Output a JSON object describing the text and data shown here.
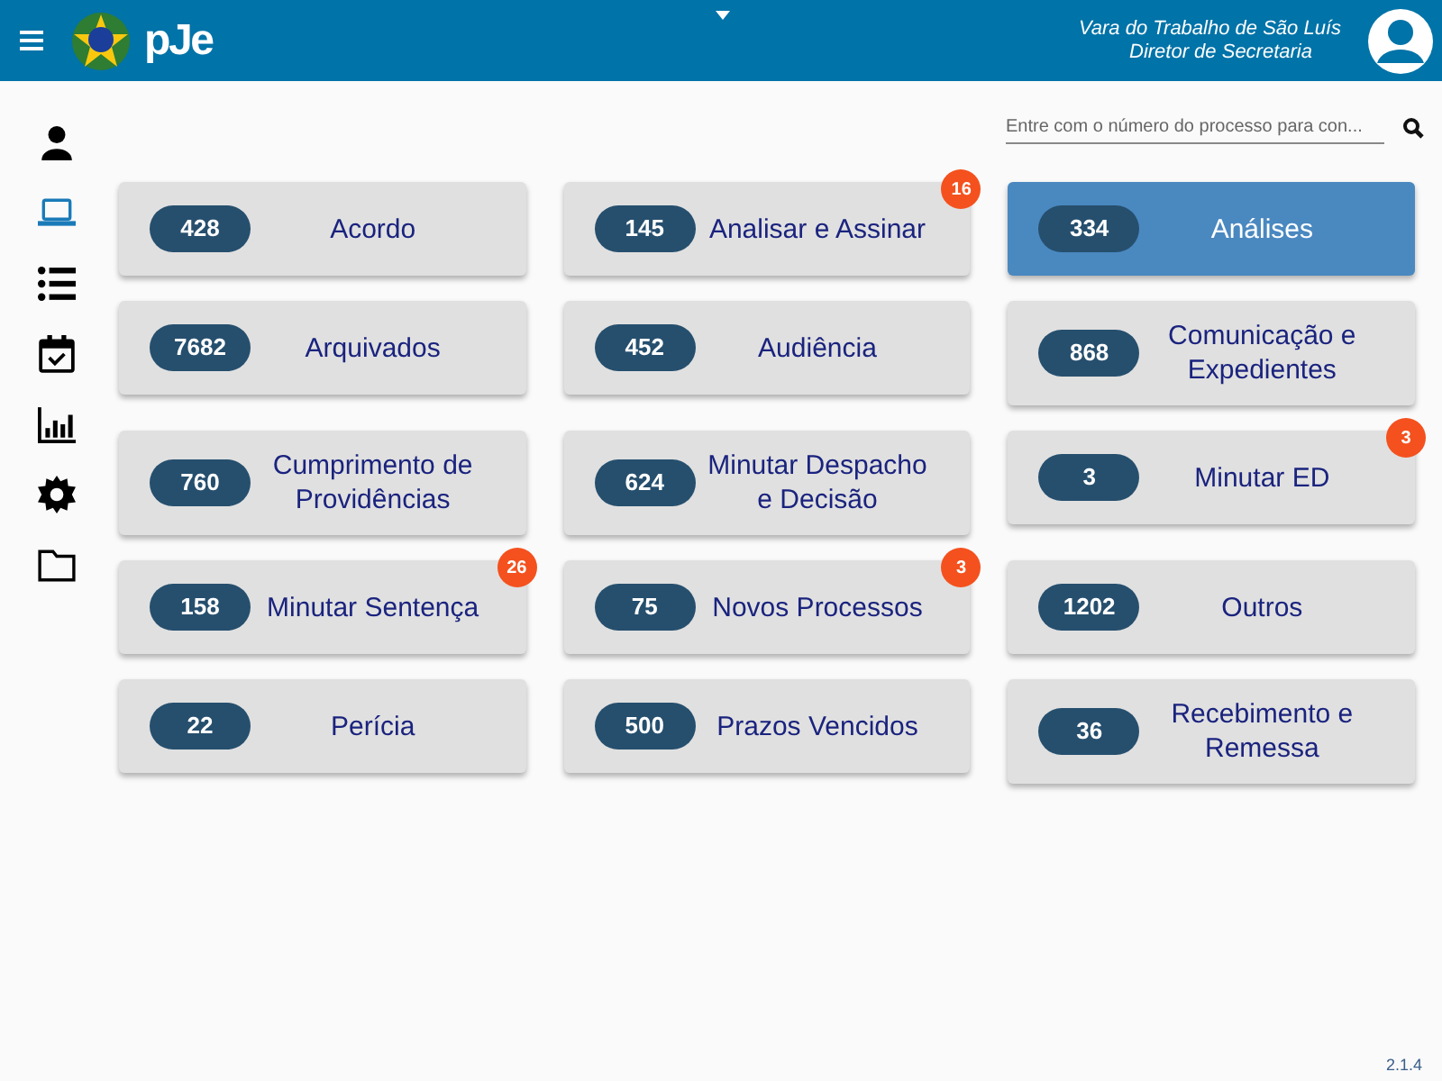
{
  "header": {
    "logo_text": "pJe",
    "org": "Vara do Trabalho de São Luís",
    "role": "Diretor de Secretaria"
  },
  "sidebar": {
    "items": [
      {
        "selected": false
      },
      {
        "selected": true
      },
      {
        "selected": false
      },
      {
        "selected": false
      },
      {
        "selected": false
      },
      {
        "selected": false
      },
      {
        "selected": false
      }
    ]
  },
  "search": {
    "placeholder": "Entre com o número do processo para con..."
  },
  "cards": [
    {
      "count": "428",
      "label": "Acordo",
      "selected": false
    },
    {
      "count": "145",
      "label": "Analisar e Assinar",
      "selected": false,
      "badge": "16"
    },
    {
      "count": "334",
      "label": "Análises",
      "selected": true
    },
    {
      "count": "7682",
      "label": "Arquivados",
      "selected": false
    },
    {
      "count": "452",
      "label": "Audiência",
      "selected": false
    },
    {
      "count": "868",
      "label": "Comunicação e Expedientes",
      "selected": false
    },
    {
      "count": "760",
      "label": "Cumprimento de Providências",
      "selected": false
    },
    {
      "count": "624",
      "label": "Minutar Despacho e Decisão",
      "selected": false
    },
    {
      "count": "3",
      "label": "Minutar ED",
      "selected": false,
      "badge": "3"
    },
    {
      "count": "158",
      "label": "Minutar Sentença",
      "selected": false,
      "badge": "26"
    },
    {
      "count": "75",
      "label": "Novos Processos",
      "selected": false,
      "badge": "3"
    },
    {
      "count": "1202",
      "label": "Outros",
      "selected": false
    },
    {
      "count": "22",
      "label": "Perícia",
      "selected": false
    },
    {
      "count": "500",
      "label": "Prazos Vencidos",
      "selected": false
    },
    {
      "count": "36",
      "label": "Recebimento e Remessa",
      "selected": false
    }
  ],
  "version": "2.1.4"
}
